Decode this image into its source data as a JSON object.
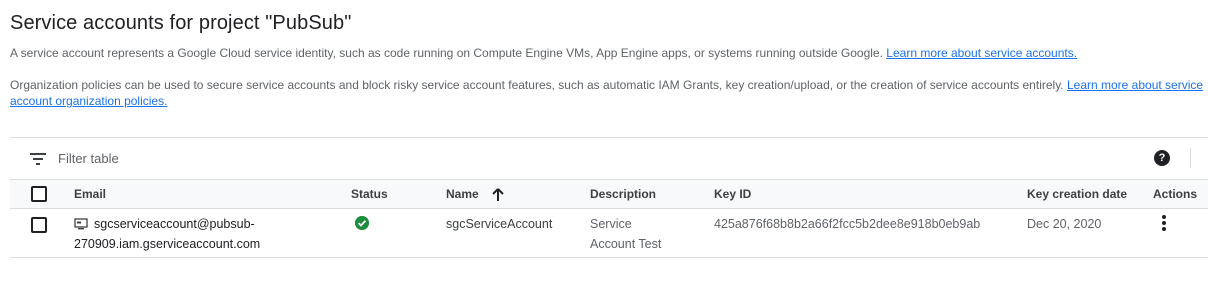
{
  "page": {
    "title": "Service accounts for project \"PubSub\"",
    "intro": "A service account represents a Google Cloud service identity, such as code running on Compute Engine VMs, App Engine apps, or systems running outside Google.",
    "intro_link": "Learn more about service accounts.",
    "policies": "Organization policies can be used to secure service accounts and block risky service account features, such as automatic IAM Grants, key creation/upload, or the creation of service accounts entirely.",
    "policies_link": "Learn more about service account organization policies."
  },
  "filter": {
    "placeholder": "Filter table",
    "icon": "filter-icon",
    "help_icon": "help-icon"
  },
  "table": {
    "headers": {
      "email": "Email",
      "status": "Status",
      "name": "Name",
      "description": "Description",
      "key_id": "Key ID",
      "key_creation_date": "Key creation date",
      "actions": "Actions"
    },
    "sort": {
      "column": "Name",
      "direction": "ascending"
    },
    "rows": [
      {
        "email_part1": "sgcserviceaccount@pubsub-",
        "email_part2": "270909.iam.gserviceaccount.com",
        "status_icon": "check-circle-icon",
        "status_color": "#1e8e3e",
        "name": "sgcServiceAccount",
        "description_part1": "Service",
        "description_part2": "Account Test",
        "key_id": "425a876f68b8b2a66f2fcc5b2dee8e918b0eb9ab",
        "key_creation_date": "Dec 20, 2020"
      }
    ]
  },
  "colors": {
    "link": "#1a73e8",
    "text": "#3c4043",
    "header_bg": "#f8f9fa",
    "border": "#dadce0"
  }
}
